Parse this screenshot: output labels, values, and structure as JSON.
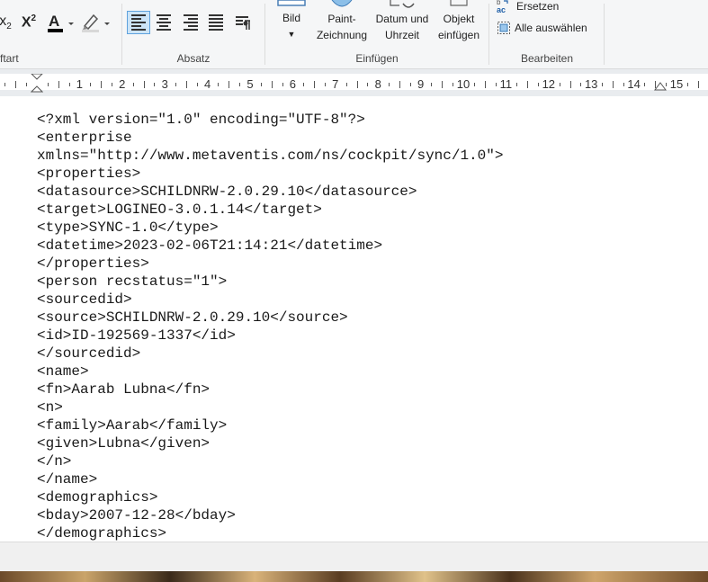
{
  "ribbon": {
    "font_group": {
      "label": "ftart"
    },
    "paragraph_group": {
      "label": "Absatz"
    },
    "insert_group": {
      "label": "Einfügen",
      "bild": "Bild",
      "paint_line1": "Paint-",
      "paint_line2": "Zeichnung",
      "datum_line1": "Datum und",
      "datum_line2": "Uhrzeit",
      "objekt_line1": "Objekt",
      "objekt_line2": "einfügen"
    },
    "edit_group": {
      "label": "Bearbeiten",
      "replace": "Ersetzen",
      "select_all": "Alle auswählen"
    }
  },
  "ruler": {
    "numbers": [
      "1",
      "2",
      "3",
      "4",
      "5",
      "6",
      "7",
      "8",
      "9",
      "10",
      "11",
      "12",
      "13",
      "14",
      "15"
    ]
  },
  "document": {
    "lines": [
      "<?xml version=\"1.0\" encoding=\"UTF-8\"?>",
      "<enterprise",
      "xmlns=\"http://www.metaventis.com/ns/cockpit/sync/1.0\">",
      "<properties>",
      "<datasource>SCHILDNRW-2.0.29.10</datasource>",
      "<target>LOGINEO-3.0.1.14</target>",
      "<type>SYNC-1.0</type>",
      "<datetime>2023-02-06T21:14:21</datetime>",
      "</properties>",
      "<person recstatus=\"1\">",
      "<sourcedid>",
      "<source>SCHILDNRW-2.0.29.10</source>",
      "<id>ID-192569-1337</id>",
      "</sourcedid>",
      "<name>",
      "<fn>Aarab Lubna</fn>",
      "<n>",
      "<family>Aarab</family>",
      "<given>Lubna</given>",
      "</n>",
      "</name>",
      "<demographics>",
      "<bday>2007-12-28</bday>",
      "</demographics>"
    ]
  }
}
